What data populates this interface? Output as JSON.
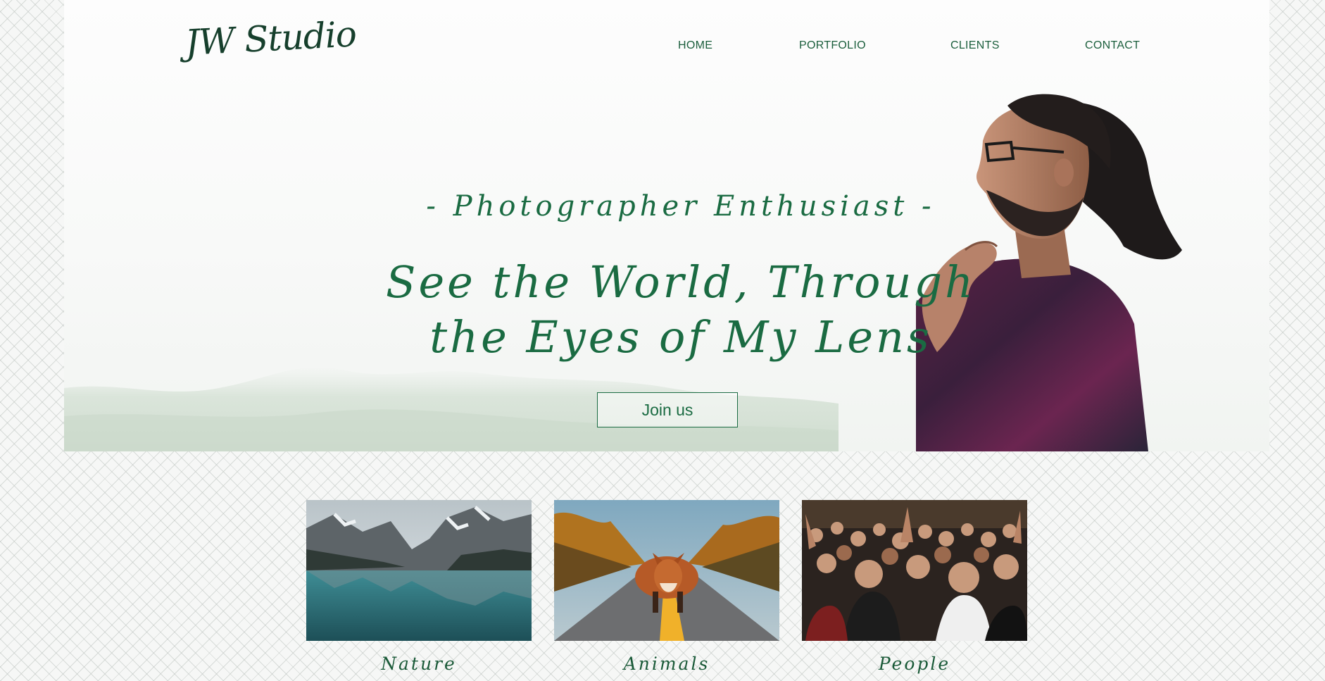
{
  "brand": {
    "logo_text": "JW Studio"
  },
  "nav": {
    "items": [
      {
        "label": "HOME"
      },
      {
        "label": "PORTFOLIO"
      },
      {
        "label": "CLIENTS"
      },
      {
        "label": "CONTACT"
      }
    ]
  },
  "hero": {
    "tagline": "- Photographer Enthusiast -",
    "headline_line1": "See the World, Through",
    "headline_line2": "the Eyes of My Lens",
    "cta_label": "Join us",
    "image": "man-portrait-glasses"
  },
  "categories": [
    {
      "label": "Nature",
      "image": "mountain-lake-photo"
    },
    {
      "label": "Animals",
      "image": "fox-on-road-photo"
    },
    {
      "label": "People",
      "image": "concert-crowd-photo"
    }
  ],
  "colors": {
    "accent": "#1a6b42",
    "logo": "#163f2c",
    "background": "#f6f7f6"
  }
}
